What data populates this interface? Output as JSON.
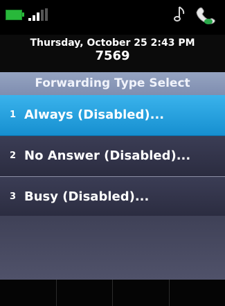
{
  "status": {
    "battery_icon": "battery-icon",
    "signal_icon": "signal-strength-icon",
    "music_icon": "music-note-icon",
    "handset_icon": "handset-icon",
    "battery_color": "#28b83a"
  },
  "header": {
    "datetime": "Thursday, October 25 2:43 PM",
    "extension": "7569"
  },
  "title": "Forwarding Type Select",
  "menu": {
    "items": [
      {
        "number": "1",
        "label": "Always (Disabled)...",
        "selected": true
      },
      {
        "number": "2",
        "label": "No Answer (Disabled)...",
        "selected": false
      },
      {
        "number": "3",
        "label": "Busy (Disabled)...",
        "selected": false
      }
    ]
  },
  "softkeys": [
    "",
    "",
    "",
    ""
  ],
  "colors": {
    "selected": "#1f9fdd",
    "title_bar": "#8a98b8",
    "background": "#3a3c52"
  }
}
